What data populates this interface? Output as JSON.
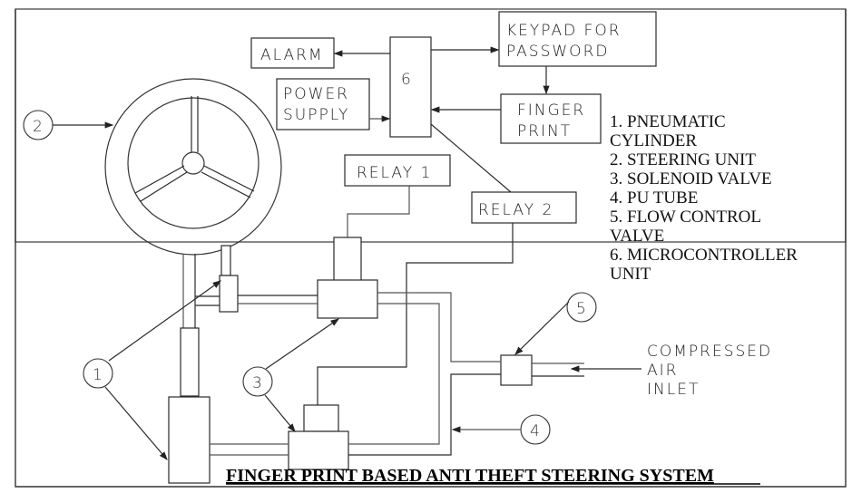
{
  "diagram": {
    "title": "FINGER PRINT BASED ANTI THEFT STEERING SYSTEM",
    "blocks": {
      "alarm": "ALARM",
      "microcontroller": "6",
      "keypad_line1": "KEYPAD FOR",
      "keypad_line2": "PASSWORD",
      "power_line1": "POWER",
      "power_line2": "SUPPLY",
      "finger_line1": "FINGER",
      "finger_line2": "PRINT",
      "relay1": "RELAY 1",
      "relay2": "RELAY 2"
    },
    "callouts": {
      "c1": "1",
      "c2": "2",
      "c3": "3",
      "c4": "4",
      "c5": "5"
    },
    "inlet": {
      "line1": "COMPRESSED",
      "line2": "AIR",
      "line3": "INLET"
    },
    "legend": [
      "1. PNEUMATIC",
      "CYLINDER",
      "2. STEERING UNIT",
      "3. SOLENOID VALVE",
      "4. PU TUBE",
      "5. FLOW CONTROL",
      "VALVE",
      "6. MICROCONTROLLER",
      "UNIT"
    ]
  }
}
